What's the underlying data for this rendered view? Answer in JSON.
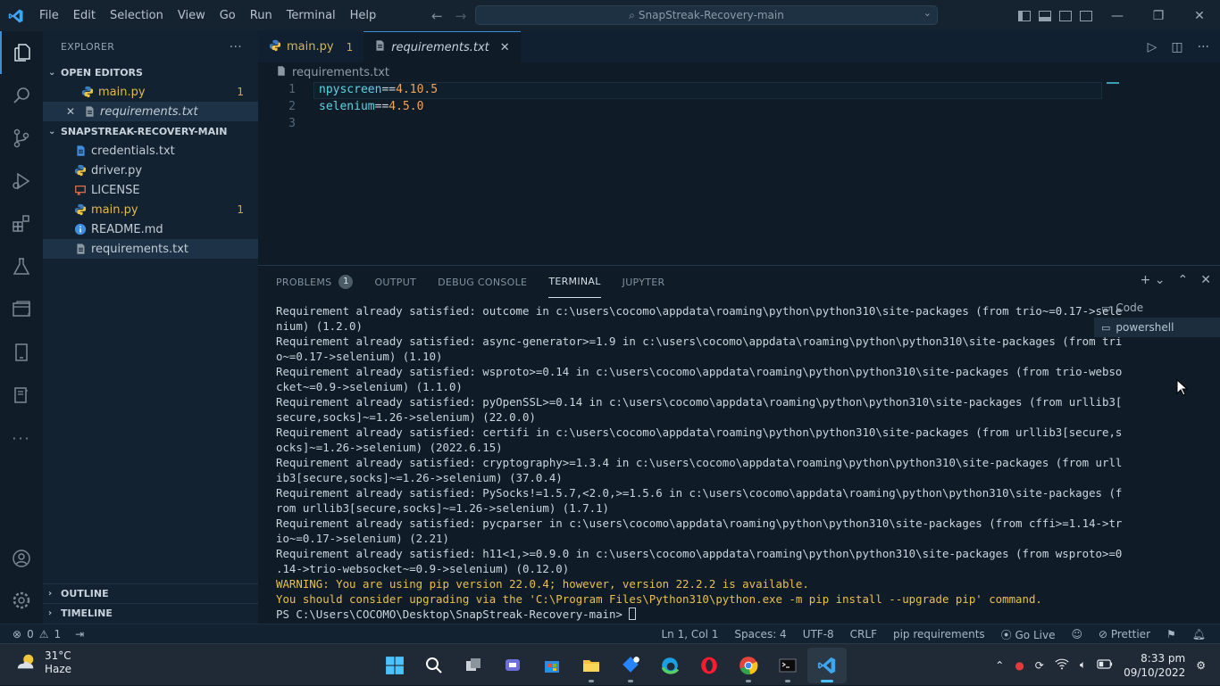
{
  "window": {
    "menu": [
      "File",
      "Edit",
      "Selection",
      "View",
      "Go",
      "Run",
      "Terminal",
      "Help"
    ],
    "search": "SnapStreak-Recovery-main"
  },
  "sidebar": {
    "title": "EXPLORER",
    "open_editors_label": "OPEN EDITORS",
    "open_editors": [
      {
        "name": "main.py",
        "badge": "1"
      },
      {
        "name": "requirements.txt",
        "badge": ""
      }
    ],
    "folder_label": "SNAPSTREAK-RECOVERY-MAIN",
    "files": [
      {
        "name": "credentials.txt",
        "badge": ""
      },
      {
        "name": "driver.py",
        "badge": ""
      },
      {
        "name": "LICENSE",
        "badge": ""
      },
      {
        "name": "main.py",
        "badge": "1"
      },
      {
        "name": "README.md",
        "badge": ""
      },
      {
        "name": "requirements.txt",
        "badge": ""
      }
    ],
    "outline_label": "OUTLINE",
    "timeline_label": "TIMELINE"
  },
  "editor": {
    "tabs": [
      {
        "name": "main.py",
        "badge": "1"
      },
      {
        "name": "requirements.txt"
      }
    ],
    "breadcrumb": "requirements.txt",
    "lines": [
      {
        "num": "1",
        "pkg": "npyscreen",
        "op": "==",
        "ver": "4.10.5"
      },
      {
        "num": "2",
        "pkg": "selenium",
        "op": "==",
        "ver": "4.5.0"
      },
      {
        "num": "3",
        "pkg": "",
        "op": "",
        "ver": ""
      }
    ]
  },
  "panel": {
    "tabs": [
      "PROBLEMS",
      "OUTPUT",
      "DEBUG CONSOLE",
      "TERMINAL",
      "JUPYTER"
    ],
    "problems_count": "1",
    "terminal_lines": [
      "Requirement already satisfied: outcome in c:\\users\\cocomo\\appdata\\roaming\\python\\python310\\site-packages (from trio~=0.17->sele",
      "nium) (1.2.0)",
      "Requirement already satisfied: async-generator>=1.9 in c:\\users\\cocomo\\appdata\\roaming\\python\\python310\\site-packages (from tri",
      "o~=0.17->selenium) (1.10)",
      "Requirement already satisfied: wsproto>=0.14 in c:\\users\\cocomo\\appdata\\roaming\\python\\python310\\site-packages (from trio-webso",
      "cket~=0.9->selenium) (1.1.0)",
      "Requirement already satisfied: pyOpenSSL>=0.14 in c:\\users\\cocomo\\appdata\\roaming\\python\\python310\\site-packages (from urllib3[",
      "secure,socks]~=1.26->selenium) (22.0.0)",
      "Requirement already satisfied: certifi in c:\\users\\cocomo\\appdata\\roaming\\python\\python310\\site-packages (from urllib3[secure,s",
      "ocks]~=1.26->selenium) (2022.6.15)",
      "Requirement already satisfied: cryptography>=1.3.4 in c:\\users\\cocomo\\appdata\\roaming\\python\\python310\\site-packages (from urll",
      "ib3[secure,socks]~=1.26->selenium) (37.0.4)",
      "Requirement already satisfied: PySocks!=1.5.7,<2.0,>=1.5.6 in c:\\users\\cocomo\\appdata\\roaming\\python\\python310\\site-packages (f",
      "rom urllib3[secure,socks]~=1.26->selenium) (1.7.1)",
      "Requirement already satisfied: pycparser in c:\\users\\cocomo\\appdata\\roaming\\python\\python310\\site-packages (from cffi>=1.14->tr",
      "io~=0.17->selenium) (2.21)",
      "Requirement already satisfied: h11<1,>=0.9.0 in c:\\users\\cocomo\\appdata\\roaming\\python\\python310\\site-packages (from wsproto>=0",
      ".14->trio-websocket~=0.9->selenium) (0.12.0)"
    ],
    "warning_lines": [
      "WARNING: You are using pip version 22.0.4; however, version 22.2.2 is available.",
      "You should consider upgrading via the 'C:\\Program Files\\Python310\\python.exe -m pip install --upgrade pip' command."
    ],
    "prompt": "PS C:\\Users\\COCOMO\\Desktop\\SnapStreak-Recovery-main> ",
    "terminals": [
      "Code",
      "powershell"
    ]
  },
  "statusbar": {
    "errors": "0",
    "warnings": "1",
    "position": "Ln 1, Col 1",
    "spaces": "Spaces: 4",
    "encoding": "UTF-8",
    "eol": "CRLF",
    "language": "pip requirements",
    "golive": "Go Live",
    "prettier": "Prettier"
  },
  "taskbar": {
    "temp": "31°C",
    "condition": "Haze",
    "time": "8:33 pm",
    "date": "09/10/2022"
  },
  "colors": {
    "accent": "#3c8fd6",
    "warning": "#e9c04e",
    "badge": "#d7a64a"
  }
}
